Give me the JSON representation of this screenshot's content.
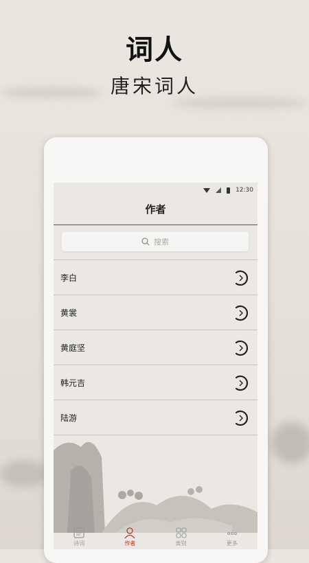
{
  "promo": {
    "headline": "词人",
    "subline": "唐宋词人"
  },
  "status_bar": {
    "time": "12:30",
    "icons": [
      "wifi-icon",
      "signal-icon",
      "battery-icon"
    ]
  },
  "nav": {
    "title": "作者"
  },
  "search": {
    "placeholder": "搜索",
    "icon": "search-icon"
  },
  "authors": [
    {
      "name": "李白"
    },
    {
      "name": "黄裳"
    },
    {
      "name": "黄庭坚"
    },
    {
      "name": "韩元吉"
    },
    {
      "name": "陆游"
    }
  ],
  "tabs": [
    {
      "label": "诗词",
      "icon": "book-icon",
      "active": false
    },
    {
      "label": "作者",
      "icon": "person-icon",
      "active": true
    },
    {
      "label": "类别",
      "icon": "grid-icon",
      "active": false
    },
    {
      "label": "更多",
      "icon": "more-icon",
      "active": false
    }
  ],
  "colors": {
    "accent": "#b53a2a",
    "background": "#e8e4de"
  }
}
